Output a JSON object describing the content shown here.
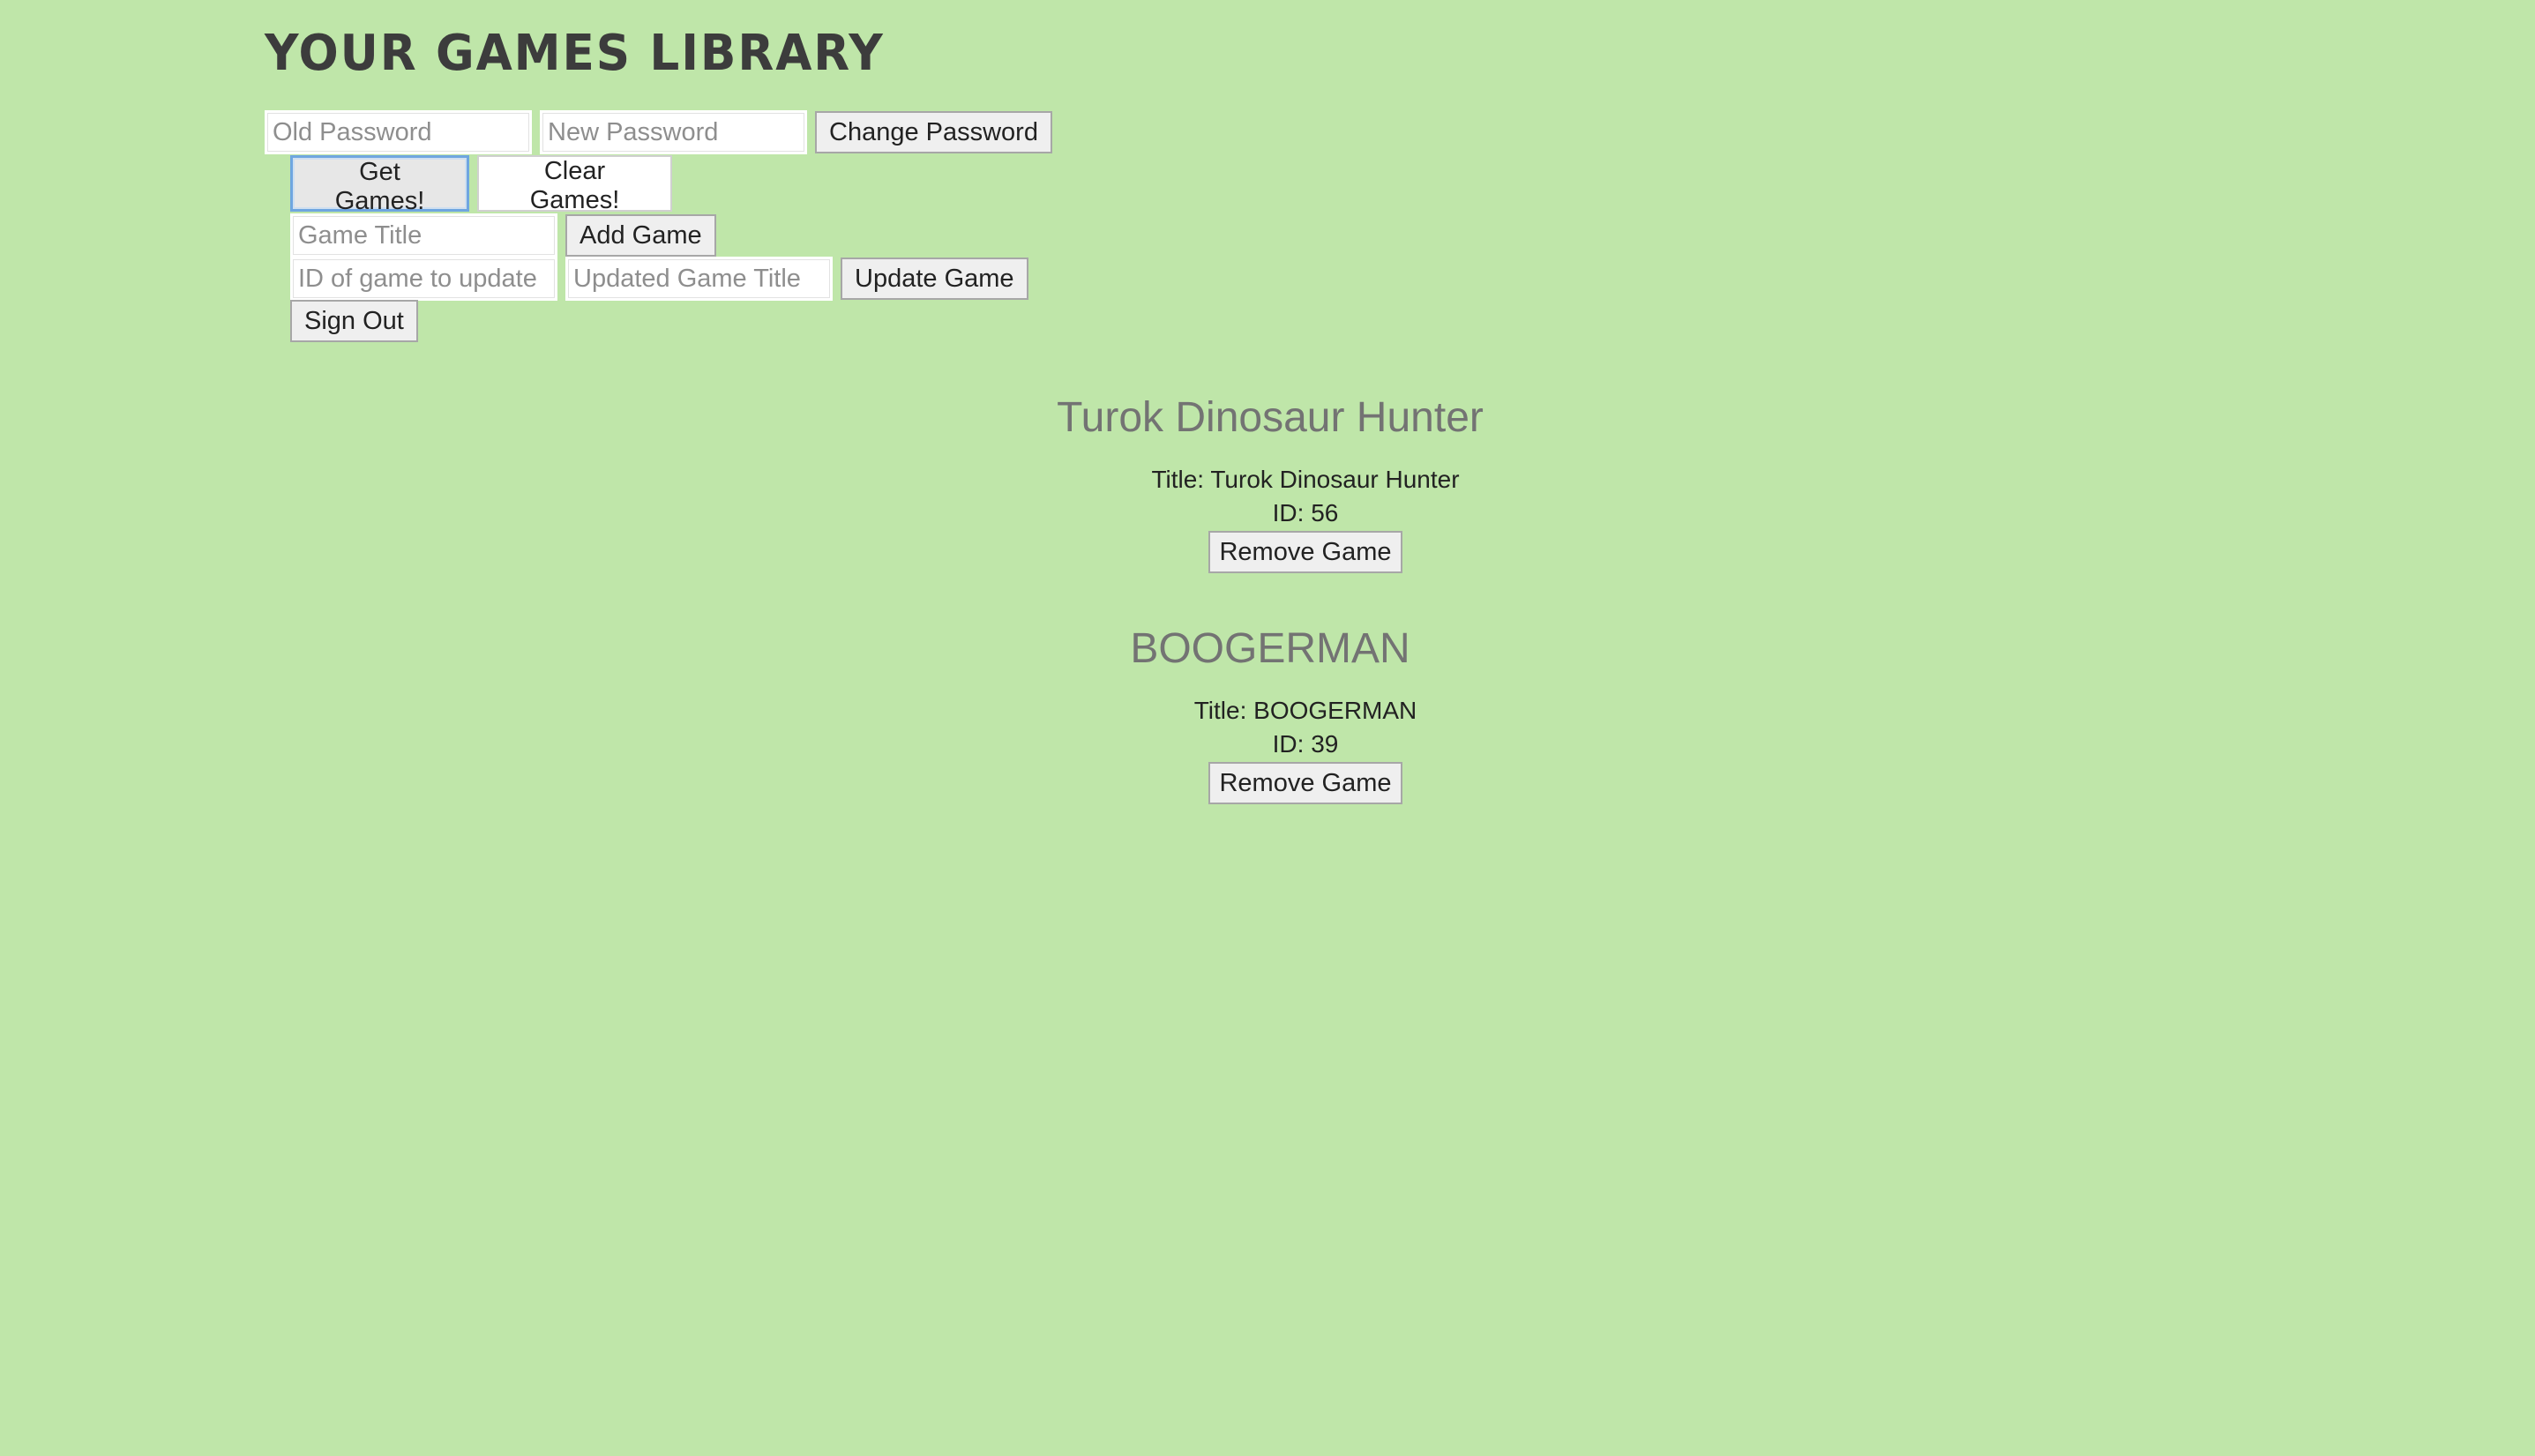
{
  "header": {
    "title": "Your Games Library"
  },
  "password_form": {
    "old_password_placeholder": "Old Password",
    "new_password_placeholder": "New Password",
    "change_password_label": "Change Password"
  },
  "actions": {
    "get_games_label": "Get Games!",
    "clear_games_label": "Clear Games!"
  },
  "add_form": {
    "game_title_placeholder": "Game Title",
    "add_game_label": "Add Game"
  },
  "update_form": {
    "id_placeholder": "ID of game to update",
    "title_placeholder": "Updated Game Title",
    "update_game_label": "Update Game"
  },
  "sign_out_label": "Sign Out",
  "games": [
    {
      "heading": "Turok Dinosaur Hunter",
      "title_line": "Title: Turok Dinosaur Hunter",
      "id_line": "ID: 56",
      "remove_label": "Remove Game"
    },
    {
      "heading": "BOOGERMAN",
      "title_line": "Title: BOOGERMAN",
      "id_line": "ID: 39",
      "remove_label": "Remove Game"
    }
  ],
  "colors": {
    "background": "#bfe6a9",
    "heading_gray": "#737373",
    "focus_blue": "#6fa6e0"
  }
}
